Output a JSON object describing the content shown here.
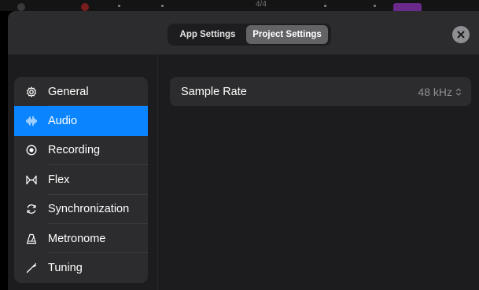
{
  "header": {
    "tabs": [
      {
        "label": "App Settings",
        "selected": false
      },
      {
        "label": "Project Settings",
        "selected": true
      }
    ],
    "background_meter": "4/4"
  },
  "sidebar": {
    "items": [
      {
        "label": "General",
        "icon": "gear-icon",
        "selected": false
      },
      {
        "label": "Audio",
        "icon": "waveform-icon",
        "selected": true
      },
      {
        "label": "Recording",
        "icon": "record-icon",
        "selected": false
      },
      {
        "label": "Flex",
        "icon": "flex-icon",
        "selected": false
      },
      {
        "label": "Synchronization",
        "icon": "sync-icon",
        "selected": false
      },
      {
        "label": "Metronome",
        "icon": "metronome-icon",
        "selected": false
      },
      {
        "label": "Tuning",
        "icon": "tuning-fork-icon",
        "selected": false
      }
    ]
  },
  "audio_settings": {
    "sample_rate_label": "Sample Rate",
    "sample_rate_value": "48 kHz"
  },
  "colors": {
    "accent": "#0a84ff",
    "panel": "#2c2c2e",
    "background": "#1c1c1e"
  }
}
